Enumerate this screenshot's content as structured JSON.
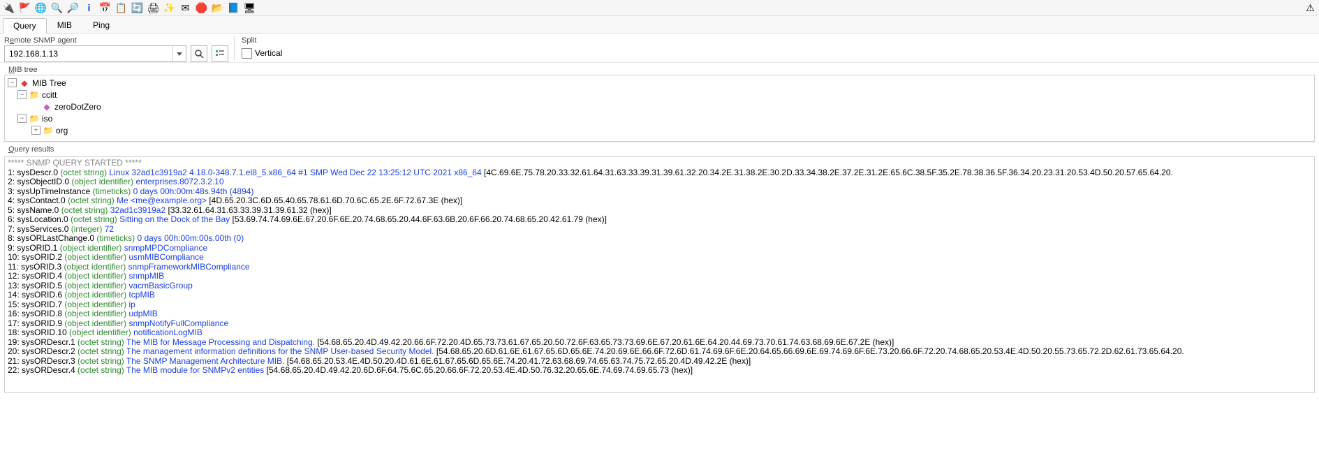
{
  "toolbar_icons": [
    "plug-icon",
    "flag-icon",
    "globe-icon",
    "zoom-icon",
    "magnify-icon",
    "info-icon",
    "calendar-icon",
    "list-icon",
    "refresh-icon",
    "print-icon",
    "wand-icon",
    "mail-icon",
    "stop-icon",
    "folder-icon",
    "book-icon",
    "exit-icon"
  ],
  "tabs": [
    {
      "label": "Query",
      "active": true
    },
    {
      "label": "MIB",
      "active": false
    },
    {
      "label": "Ping",
      "active": false
    }
  ],
  "agent": {
    "group_label_pre": "R",
    "group_label_u": "e",
    "group_label_post": "mote SNMP agent",
    "value": "192.168.1.13"
  },
  "split": {
    "label": "Split",
    "vertical": "Vertical",
    "checked": false
  },
  "mibtree": {
    "label_u": "M",
    "label_post": "IB tree",
    "root": "MIB Tree",
    "nodes": [
      {
        "level": 1,
        "icon": "folder",
        "label": "ccitt",
        "expanded": true
      },
      {
        "level": 2,
        "icon": "leaf",
        "label": "zeroDotZero",
        "expanded": null
      },
      {
        "level": 1,
        "icon": "folder",
        "label": "iso",
        "expanded": true
      },
      {
        "level": 2,
        "icon": "folder",
        "label": "org",
        "expanded": false
      }
    ]
  },
  "queryresults_label_u": "Q",
  "queryresults_label_post": "uery results",
  "query_header": "***** SNMP QUERY STARTED *****",
  "lines": [
    {
      "n": "1",
      "name": "sysDescr.0",
      "type": "(octet string)",
      "val": "Linux 32ad1c3919a2 4.18.0-348.7.1.el8_5.x86_64 #1 SMP Wed Dec 22 13:25:12 UTC 2021 x86_64",
      "hex": "[4C.69.6E.75.78.20.33.32.61.64.31.63.33.39.31.39.61.32.20.34.2E.31.38.2E.30.2D.33.34.38.2E.37.2E.31.2E.65.6C.38.5F.35.2E.78.38.36.5F.36.34.20.23.31.20.53.4D.50.20.57.65.64.20."
    },
    {
      "n": "2",
      "name": "sysObjectID.0",
      "type": "(object identifier)",
      "val": "enterprises.8072.3.2.10",
      "hex": ""
    },
    {
      "n": "3",
      "name": "sysUpTimeInstance",
      "type": "(timeticks)",
      "val": "0 days 00h:00m:48s.94th (4894)",
      "hex": ""
    },
    {
      "n": "4",
      "name": "sysContact.0",
      "type": "(octet string)",
      "val": "Me <me@example.org>",
      "hex": "[4D.65.20.3C.6D.65.40.65.78.61.6D.70.6C.65.2E.6F.72.67.3E (hex)]"
    },
    {
      "n": "5",
      "name": "sysName.0",
      "type": "(octet string)",
      "val": "32ad1c3919a2",
      "hex": "[33.32.61.64.31.63.33.39.31.39.61.32 (hex)]"
    },
    {
      "n": "6",
      "name": "sysLocation.0",
      "type": "(octet string)",
      "val": "Sitting on the Dock of the Bay",
      "hex": "[53.69.74.74.69.6E.67.20.6F.6E.20.74.68.65.20.44.6F.63.6B.20.6F.66.20.74.68.65.20.42.61.79 (hex)]"
    },
    {
      "n": "7",
      "name": "sysServices.0",
      "type": "(integer)",
      "val": "72",
      "hex": ""
    },
    {
      "n": "8",
      "name": "sysORLastChange.0",
      "type": "(timeticks)",
      "val": "0 days 00h:00m:00s.00th (0)",
      "hex": ""
    },
    {
      "n": "9",
      "name": "sysORID.1",
      "type": "(object identifier)",
      "val": "snmpMPDCompliance",
      "hex": ""
    },
    {
      "n": "10",
      "name": "sysORID.2",
      "type": "(object identifier)",
      "val": "usmMIBCompliance",
      "hex": ""
    },
    {
      "n": "11",
      "name": "sysORID.3",
      "type": "(object identifier)",
      "val": "snmpFrameworkMIBCompliance",
      "hex": ""
    },
    {
      "n": "12",
      "name": "sysORID.4",
      "type": "(object identifier)",
      "val": "snmpMIB",
      "hex": ""
    },
    {
      "n": "13",
      "name": "sysORID.5",
      "type": "(object identifier)",
      "val": "vacmBasicGroup",
      "hex": ""
    },
    {
      "n": "14",
      "name": "sysORID.6",
      "type": "(object identifier)",
      "val": "tcpMIB",
      "hex": ""
    },
    {
      "n": "15",
      "name": "sysORID.7",
      "type": "(object identifier)",
      "val": "ip",
      "hex": ""
    },
    {
      "n": "16",
      "name": "sysORID.8",
      "type": "(object identifier)",
      "val": "udpMIB",
      "hex": ""
    },
    {
      "n": "17",
      "name": "sysORID.9",
      "type": "(object identifier)",
      "val": "snmpNotifyFullCompliance",
      "hex": ""
    },
    {
      "n": "18",
      "name": "sysORID.10",
      "type": "(object identifier)",
      "val": "notificationLogMIB",
      "hex": ""
    },
    {
      "n": "19",
      "name": "sysORDescr.1",
      "type": "(octet string)",
      "val": "The MIB for Message Processing and Dispatching.",
      "hex": "[54.68.65.20.4D.49.42.20.66.6F.72.20.4D.65.73.73.61.67.65.20.50.72.6F.63.65.73.73.69.6E.67.20.61.6E.64.20.44.69.73.70.61.74.63.68.69.6E.67.2E (hex)]"
    },
    {
      "n": "20",
      "name": "sysORDescr.2",
      "type": "(octet string)",
      "val": "The management information definitions for the SNMP User-based Security Model.",
      "hex": "[54.68.65.20.6D.61.6E.61.67.65.6D.65.6E.74.20.69.6E.66.6F.72.6D.61.74.69.6F.6E.20.64.65.66.69.6E.69.74.69.6F.6E.73.20.66.6F.72.20.74.68.65.20.53.4E.4D.50.20.55.73.65.72.2D.62.61.73.65.64.20."
    },
    {
      "n": "21",
      "name": "sysORDescr.3",
      "type": "(octet string)",
      "val": "The SNMP Management Architecture MIB.",
      "hex": "[54.68.65.20.53.4E.4D.50.20.4D.61.6E.61.67.65.6D.65.6E.74.20.41.72.63.68.69.74.65.63.74.75.72.65.20.4D.49.42.2E (hex)]"
    },
    {
      "n": "22",
      "name": "sysORDescr.4",
      "type": "(octet string)",
      "val": "The MIB module for SNMPv2 entities",
      "hex": "[54.68.65.20.4D.49.42.20.6D.6F.64.75.6C.65.20.66.6F.72.20.53.4E.4D.50.76.32.20.65.6E.74.69.74.69.65.73 (hex)]"
    }
  ]
}
